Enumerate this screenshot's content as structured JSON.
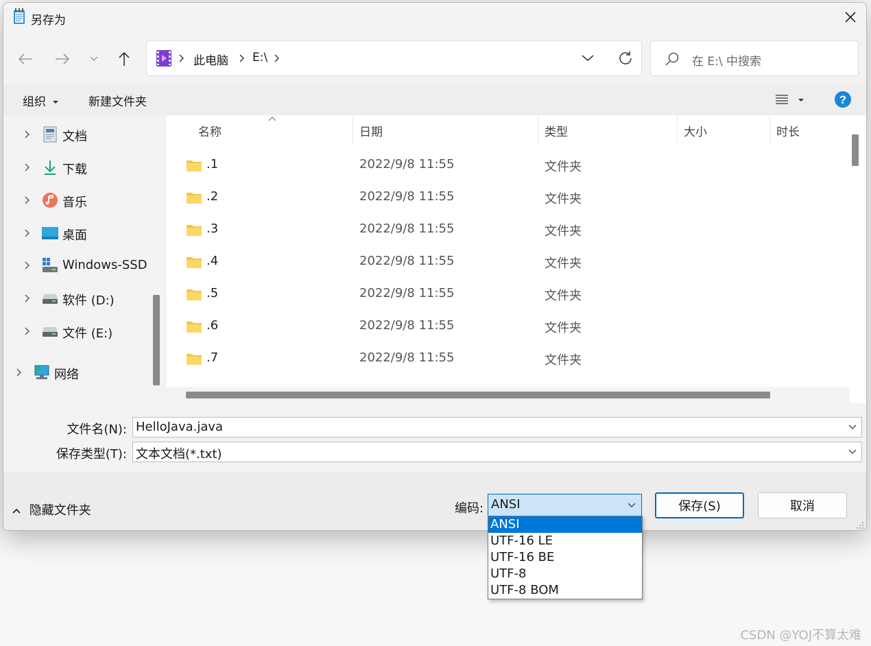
{
  "window": {
    "title": "另存为"
  },
  "nav": {
    "breadcrumbs": [
      "此电脑",
      "E:\\"
    ],
    "search_placeholder": "在 E:\\ 中搜索"
  },
  "toolbar": {
    "organize_label": "组织",
    "new_folder_label": "新建文件夹"
  },
  "sidebar": {
    "items": [
      {
        "label": "文档",
        "icon": "documents-icon"
      },
      {
        "label": "下载",
        "icon": "download-icon"
      },
      {
        "label": "音乐",
        "icon": "music-icon"
      },
      {
        "label": "桌面",
        "icon": "desktop-icon"
      },
      {
        "label": "Windows-SSD",
        "icon": "drive-c-icon"
      },
      {
        "label": "软件 (D:)",
        "icon": "drive-icon"
      },
      {
        "label": "文件 (E:)",
        "icon": "drive-icon"
      },
      {
        "label": "网络",
        "icon": "network-icon"
      }
    ]
  },
  "file_list": {
    "columns": [
      "名称",
      "日期",
      "类型",
      "大小",
      "时长"
    ],
    "rows": [
      {
        "name": ".1",
        "date": "2022/9/8 11:55",
        "type": "文件夹"
      },
      {
        "name": ".2",
        "date": "2022/9/8 11:55",
        "type": "文件夹"
      },
      {
        "name": ".3",
        "date": "2022/9/8 11:55",
        "type": "文件夹"
      },
      {
        "name": ".4",
        "date": "2022/9/8 11:55",
        "type": "文件夹"
      },
      {
        "name": ".5",
        "date": "2022/9/8 11:55",
        "type": "文件夹"
      },
      {
        "name": ".6",
        "date": "2022/9/8 11:55",
        "type": "文件夹"
      },
      {
        "name": ".7",
        "date": "2022/9/8 11:55",
        "type": "文件夹"
      }
    ]
  },
  "form": {
    "filename_label": "文件名(N):",
    "filename_value": "HelloJava.java",
    "filetype_label": "保存类型(T):",
    "filetype_value": "文本文档(*.txt)"
  },
  "footer": {
    "hide_folders_label": "隐藏文件夹",
    "encoding_label": "编码:",
    "encoding_value": "ANSI",
    "save_label": "保存(S)",
    "cancel_label": "取消"
  },
  "encoding_options": [
    "ANSI",
    "UTF-16 LE",
    "UTF-16 BE",
    "UTF-8",
    "UTF-8 BOM"
  ],
  "watermark": "CSDN @YOJ不算太难",
  "colors": {
    "accent": "#0078d7",
    "folder": "#f8c443",
    "help": "#1a86d9"
  }
}
